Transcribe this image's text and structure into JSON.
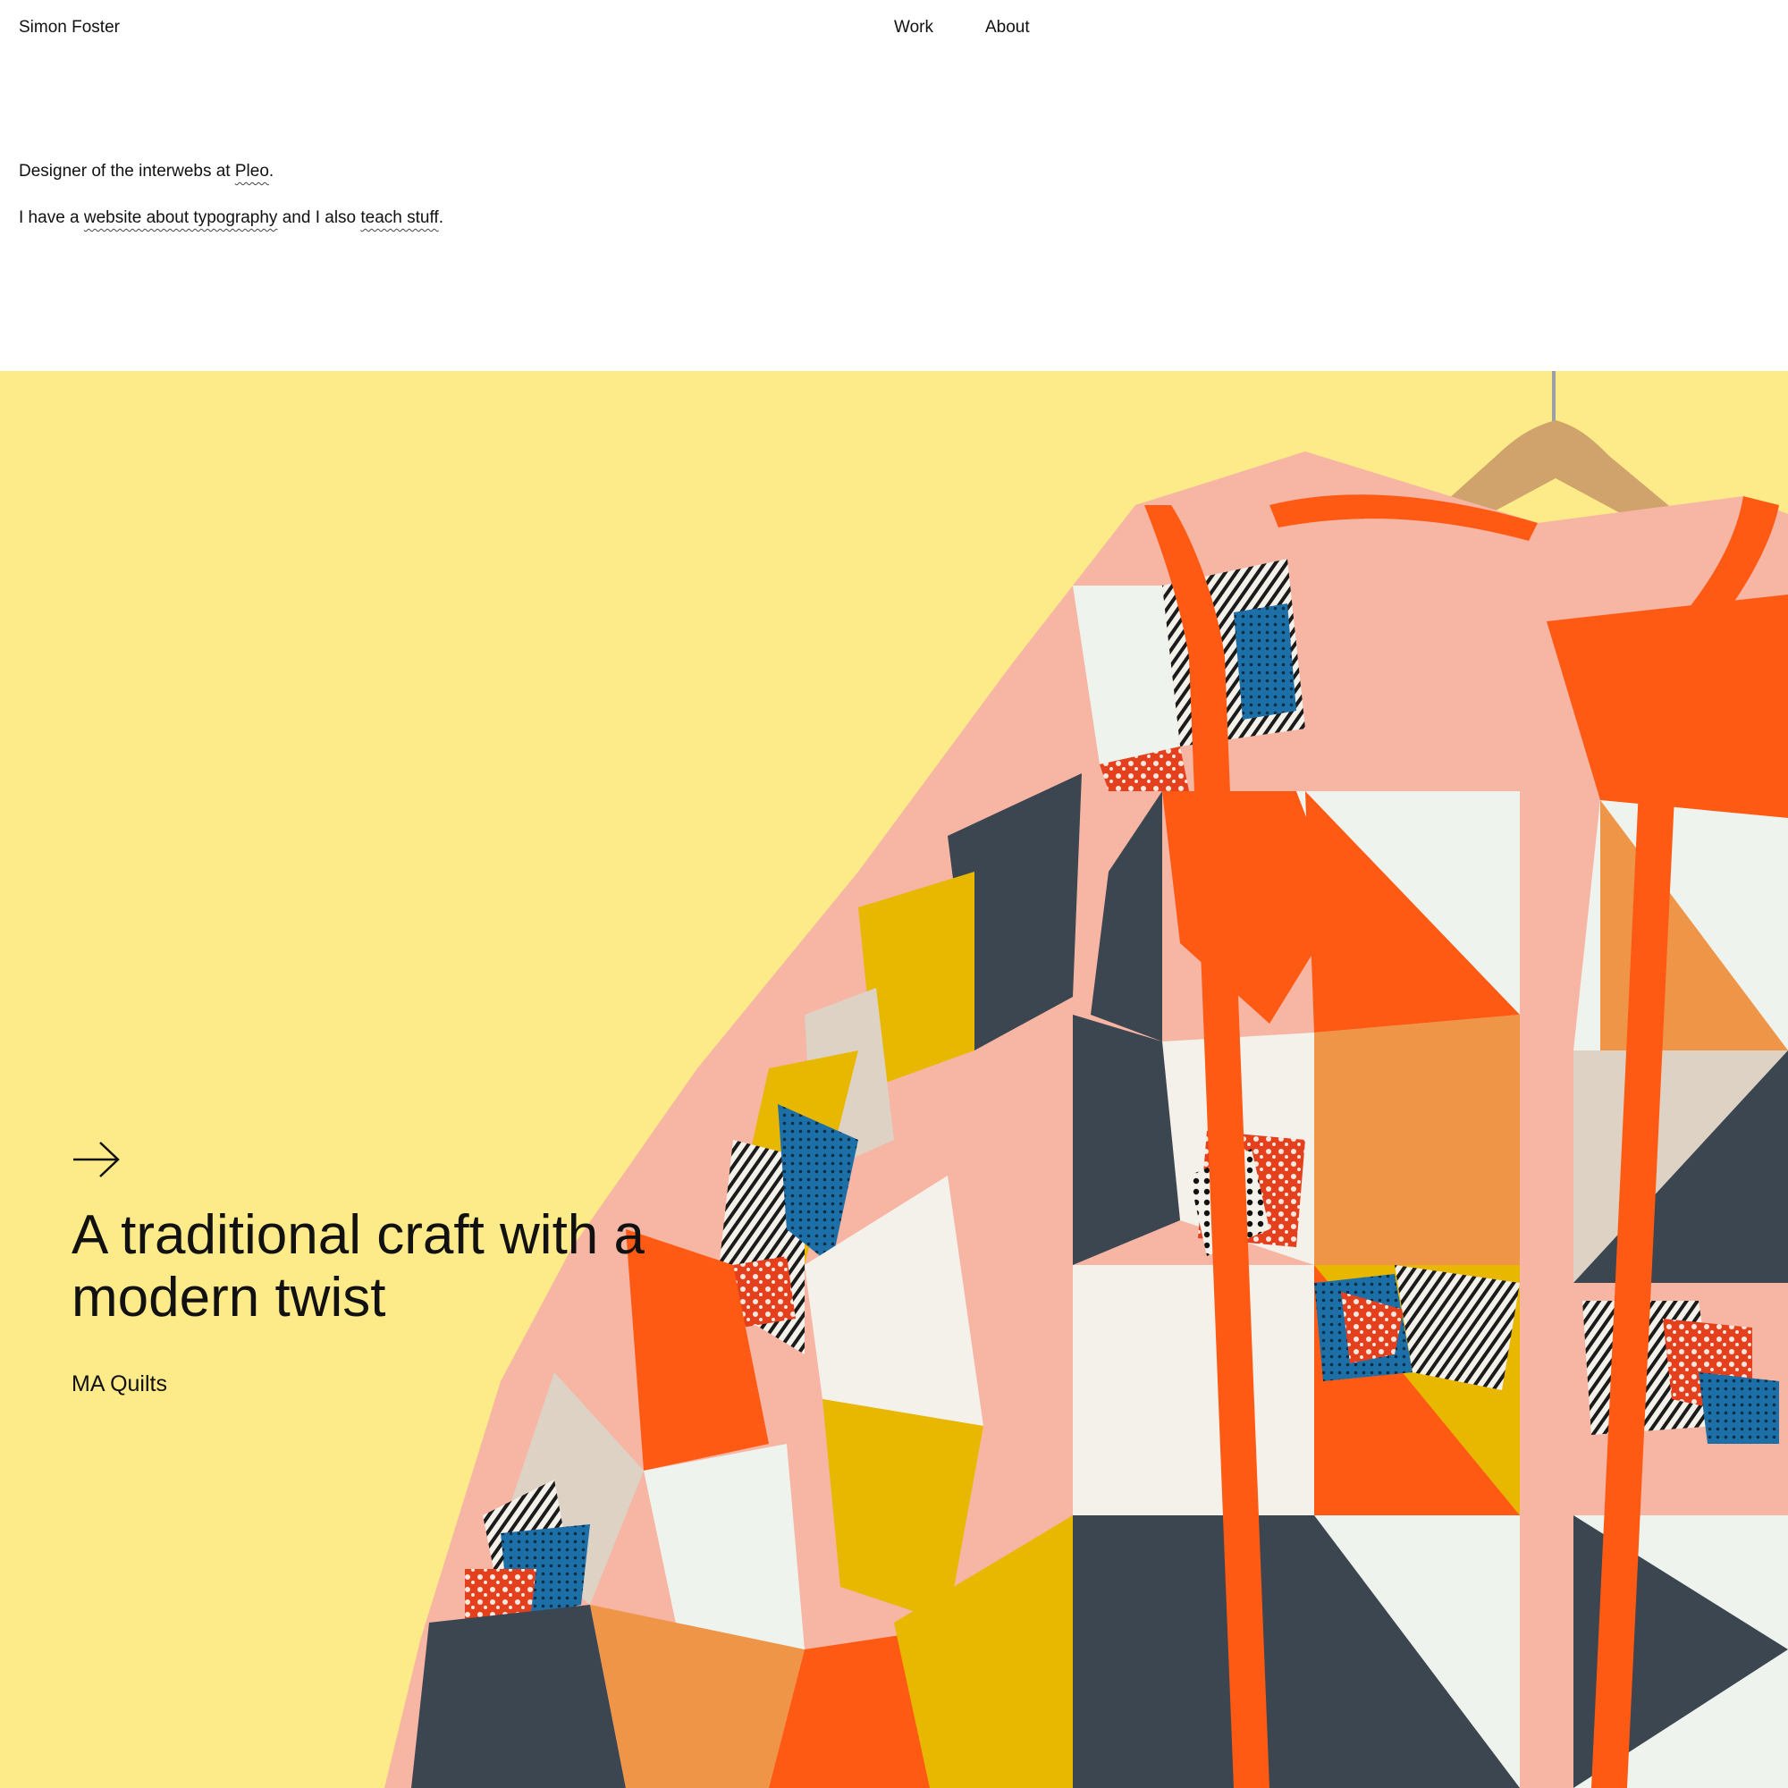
{
  "header": {
    "site_name": "Simon Foster",
    "nav": [
      {
        "label": "Work"
      },
      {
        "label": "About"
      }
    ]
  },
  "intro": {
    "line1_prefix": "Designer of the interwebs at ",
    "line1_link": "Pleo",
    "line1_suffix": ".",
    "line2_prefix": "I have a ",
    "line2_link1": "website about typography",
    "line2_mid": " and I also ",
    "line2_link2": "teach stuff",
    "line2_suffix": "."
  },
  "hero": {
    "background_color": "#fdeb8a",
    "arrow_icon": "arrow-right-icon",
    "title": "A traditional craft with a modern twist",
    "subtitle": "MA Quilts"
  }
}
